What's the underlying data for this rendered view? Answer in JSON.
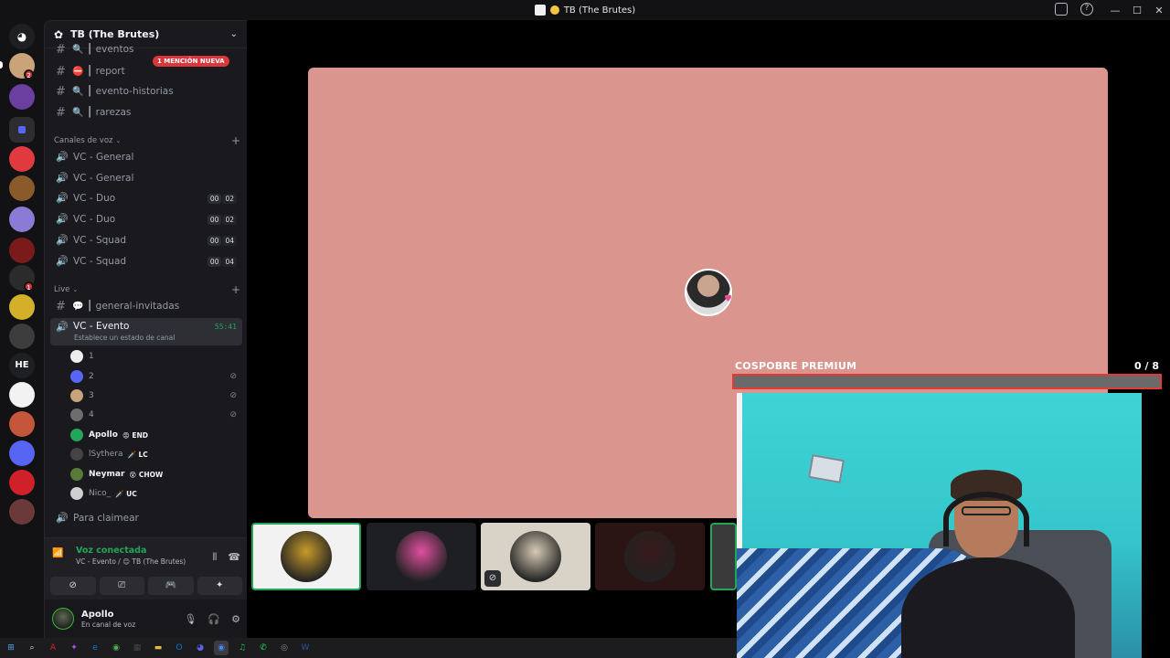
{
  "window": {
    "title": "TB (The Brutes)",
    "controls": [
      "—",
      "☐",
      "✕"
    ]
  },
  "rail": {
    "servers": [
      {
        "name": "discord-home-icon",
        "color": "#1e1f22"
      },
      {
        "name": "server-1",
        "color": "#c9a47a",
        "badge": "2"
      },
      {
        "name": "server-2",
        "color": "#6b3fa0"
      },
      {
        "name": "server-folder",
        "color": "#5865f2"
      },
      {
        "name": "server-3",
        "color": "#e03a3e"
      },
      {
        "name": "server-4",
        "color": "#8a5a2b"
      },
      {
        "name": "server-5",
        "color": "#8c7ad6"
      },
      {
        "name": "server-6",
        "color": "#7a1a1a"
      },
      {
        "name": "server-7",
        "color": "#2b2b2b",
        "badge": "1"
      },
      {
        "name": "server-8",
        "color": "#d4b02a"
      },
      {
        "name": "server-9",
        "color": "#3c3c3c"
      },
      {
        "name": "server-he",
        "text": "HE"
      },
      {
        "name": "server-10",
        "color": "#f2f2f2"
      },
      {
        "name": "server-11",
        "color": "#c4563c"
      },
      {
        "name": "server-12",
        "color": "#5865f2"
      },
      {
        "name": "server-13",
        "color": "#d0202a"
      },
      {
        "name": "server-14",
        "color": "#6a3a3a"
      }
    ]
  },
  "sidebar": {
    "server_name": "TB (The Brutes)",
    "mention_badge": "1 MENCIÓN NUEVA",
    "text_channels": [
      {
        "label": "┃ eventos",
        "glyph": "🔍"
      },
      {
        "label": "┃ report",
        "glyph": "⛔"
      },
      {
        "label": "┃ evento-historias",
        "glyph": "🔍"
      },
      {
        "label": "┃ rarezas",
        "glyph": "🔍"
      }
    ],
    "voice_category": "Canales de voz",
    "voice_channels": [
      {
        "label": "VC - General"
      },
      {
        "label": "VC - General"
      },
      {
        "label": "VC - Duo",
        "count": [
          "00",
          "02"
        ]
      },
      {
        "label": "VC - Duo",
        "count": [
          "00",
          "02"
        ]
      },
      {
        "label": "VC - Squad",
        "count": [
          "00",
          "04"
        ]
      },
      {
        "label": "VC - Squad",
        "count": [
          "00",
          "04"
        ]
      }
    ],
    "live_category": "Live",
    "live_text_channel": "┃ general-invitadas",
    "active_channel": {
      "label": "VC - Evento",
      "timer": "55:41",
      "status": "Establece un estado de canal"
    },
    "voice_users": [
      {
        "name": "1",
        "color": "#eeeeee"
      },
      {
        "name": "2",
        "color": "#5865f2",
        "muted": true
      },
      {
        "name": "3",
        "color": "#c9a47a",
        "muted": true
      },
      {
        "name": "4",
        "color": "#6d6d6d",
        "muted": true
      },
      {
        "name": "Apollo",
        "tag": "😡 END",
        "color": "#23a55a",
        "bold": true
      },
      {
        "name": "lSythera",
        "tag": "🗡️ LC",
        "color": "#444"
      },
      {
        "name": "Neymar",
        "tag": "😵 CHOW",
        "color": "#5a7a3a",
        "bold": true
      },
      {
        "name": "Nico_",
        "tag": "🗡️ UC",
        "color": "#cfcfcf"
      }
    ],
    "claim_channel": "Para claimear"
  },
  "voice_panel": {
    "status": "Voz conectada",
    "channel": "VC - Evento / 😊 TB (The Brutes)",
    "user": {
      "name": "Apollo",
      "status": "En canal de voz"
    }
  },
  "stage": {
    "focus_bg": "#d9958e",
    "tiles": [
      {
        "name": "tile-1",
        "speaking": true,
        "color": "#c79a2a"
      },
      {
        "name": "tile-2",
        "color": "#e04fa0"
      },
      {
        "name": "tile-3",
        "color": "#d6cbb5",
        "muted": true
      },
      {
        "name": "tile-4",
        "color": "#3a1a1a"
      }
    ]
  },
  "overlay": {
    "label": "COSPOBRE PREMIUM",
    "count": "0  / 8",
    "progress": 0
  },
  "taskbar": {
    "items": [
      "windows-icon",
      "search-icon",
      "adobe-icon",
      "figma-icon",
      "edge-icon",
      "chrome-icon",
      "calculator-icon",
      "folder-icon",
      "outlook-icon",
      "discord-icon",
      "chrome-active-icon",
      "spotify-icon",
      "whatsapp-icon",
      "obs-icon",
      "word-icon"
    ]
  }
}
